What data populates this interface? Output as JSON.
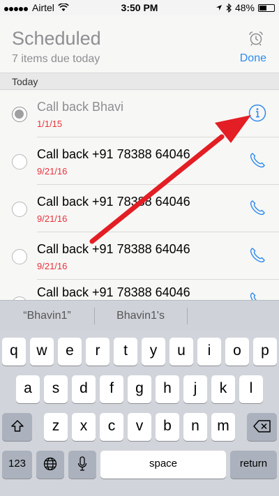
{
  "status": {
    "carrier": "Airtel",
    "time": "3:50 PM",
    "battery": "48%",
    "battery_level": 0.48
  },
  "header": {
    "title": "Scheduled",
    "subtitle": "7 items due today",
    "done_label": "Done"
  },
  "section": {
    "label": "Today"
  },
  "reminders": [
    {
      "title": "Call back Bhavi",
      "date": "1/1/15",
      "completed": true
    },
    {
      "title": "Call back +91 78388 64046",
      "date": "9/21/16",
      "completed": false
    },
    {
      "title": "Call back +91 78388 64046",
      "date": "9/21/16",
      "completed": false
    },
    {
      "title": "Call back +91 78388 64046",
      "date": "9/21/16",
      "completed": false
    },
    {
      "title": "Call back +91 78388 64046",
      "date": "",
      "completed": false
    }
  ],
  "keyboard": {
    "suggestions": [
      "“Bhavin1”",
      "Bhavin1's"
    ],
    "row1": [
      "q",
      "w",
      "e",
      "r",
      "t",
      "y",
      "u",
      "i",
      "o",
      "p"
    ],
    "row2": [
      "a",
      "s",
      "d",
      "f",
      "g",
      "h",
      "j",
      "k",
      "l"
    ],
    "row3": [
      "z",
      "x",
      "c",
      "v",
      "b",
      "n",
      "m"
    ],
    "numbers_key": "123",
    "space_key": "space",
    "return_key": "return"
  },
  "colors": {
    "accent": "#2e8af0",
    "date_red": "#e8323c",
    "arrow_red": "#e31e24"
  }
}
